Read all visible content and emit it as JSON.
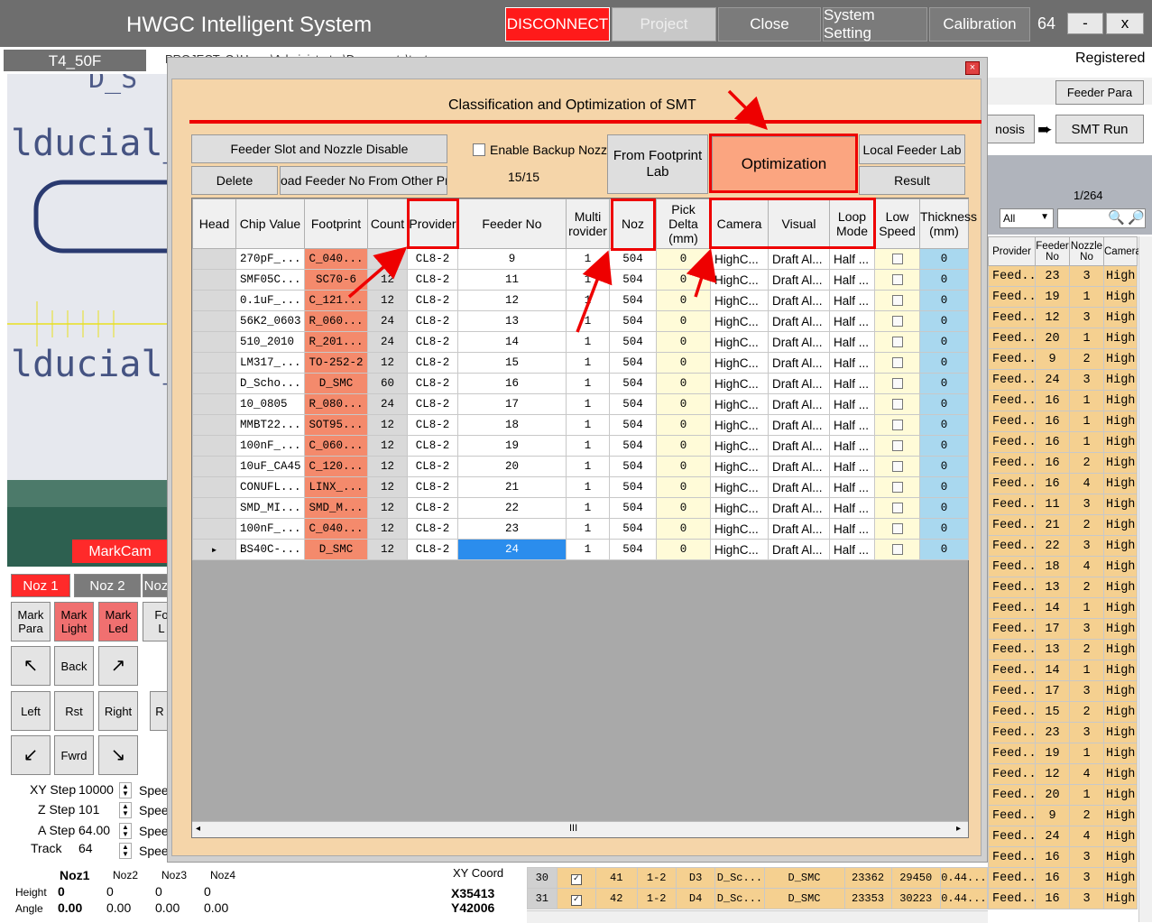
{
  "app": {
    "title": "HWGC Intelligent System",
    "disconnect": "DISCONNECT",
    "project": "Project",
    "close": "Close",
    "system_setting": "System Setting",
    "calibration": "Calibration",
    "count": "64",
    "minimize": "-",
    "close_x": "x"
  },
  "subbar": {
    "tab": "T4_50F",
    "path": "PROJECT: C:\\Users\\Administrator\\Documents\\test.pr",
    "registered": "Registered"
  },
  "right_panel": {
    "feeder_para": "Feeder Para",
    "diagnosis": "nosis",
    "smt_run": "SMT Run",
    "page": "1/264",
    "filter": "All",
    "headers": [
      "Provider",
      "Feeder No",
      "Nozzle No",
      "Camera"
    ],
    "rows": [
      [
        "Feed...",
        "23",
        "3",
        "High"
      ],
      [
        "Feed...",
        "19",
        "1",
        "High"
      ],
      [
        "Feed...",
        "12",
        "3",
        "High"
      ],
      [
        "Feed...",
        "20",
        "1",
        "High"
      ],
      [
        "Feed...",
        "9",
        "2",
        "High"
      ],
      [
        "Feed...",
        "24",
        "3",
        "High"
      ],
      [
        "Feed...",
        "16",
        "1",
        "High"
      ],
      [
        "Feed...",
        "16",
        "1",
        "High"
      ],
      [
        "Feed...",
        "16",
        "1",
        "High"
      ],
      [
        "Feed...",
        "16",
        "2",
        "High"
      ],
      [
        "Feed...",
        "16",
        "4",
        "High"
      ],
      [
        "Feed...",
        "11",
        "3",
        "High"
      ],
      [
        "Feed...",
        "21",
        "2",
        "High"
      ],
      [
        "Feed...",
        "22",
        "3",
        "High"
      ],
      [
        "Feed...",
        "18",
        "4",
        "High"
      ],
      [
        "Feed...",
        "13",
        "2",
        "High"
      ],
      [
        "Feed...",
        "14",
        "1",
        "High"
      ],
      [
        "Feed...",
        "17",
        "3",
        "High"
      ],
      [
        "Feed...",
        "13",
        "2",
        "High"
      ],
      [
        "Feed...",
        "14",
        "1",
        "High"
      ],
      [
        "Feed...",
        "17",
        "3",
        "High"
      ],
      [
        "Feed...",
        "15",
        "2",
        "High"
      ],
      [
        "Feed...",
        "23",
        "3",
        "High"
      ],
      [
        "Feed...",
        "19",
        "1",
        "High"
      ],
      [
        "Feed...",
        "12",
        "4",
        "High"
      ],
      [
        "Feed...",
        "20",
        "1",
        "High"
      ],
      [
        "Feed...",
        "9",
        "2",
        "High"
      ],
      [
        "Feed...",
        "24",
        "4",
        "High"
      ],
      [
        "Feed...",
        "16",
        "3",
        "High"
      ],
      [
        "Feed...",
        "16",
        "3",
        "High"
      ],
      [
        "Feed...",
        "16",
        "3",
        "High"
      ]
    ],
    "bottom_rows": [
      [
        "30",
        "41",
        "1-2",
        "D3",
        "D_Sc...",
        "D_SMC",
        "23362",
        "29450",
        "0.44..."
      ],
      [
        "31",
        "42",
        "1-2",
        "D4",
        "D_Sc...",
        "D_SMC",
        "23353",
        "30223",
        "0.44..."
      ]
    ]
  },
  "left": {
    "markcam": "MarkCam",
    "noz1": "Noz 1",
    "noz2": "Noz 2",
    "noz3": "Noz",
    "mark_para": "Mark Para",
    "mark_light": "Mark Light",
    "mark_led": "Mark Led",
    "fo": "Fo L",
    "back": "Back",
    "left": "Left",
    "rst": "Rst",
    "right": "Right",
    "fwrd": "Fwrd",
    "r": "R",
    "xy_step_label": "XY Step",
    "xy_step": "10000",
    "z_step_label": "Z Step",
    "z_step": "101",
    "a_step_label": "A Step",
    "a_step": "64.00",
    "track_label": "Track",
    "track": "64",
    "speed": "Spee",
    "noz_cols": [
      "Noz1",
      "Noz2",
      "Noz3",
      "Noz4"
    ],
    "height_label": "Height",
    "angle_label": "Angle",
    "heights": [
      "0",
      "0",
      "0",
      "0"
    ],
    "angles": [
      "0.00",
      "0.00",
      "0.00",
      "0.00"
    ],
    "xy_coord": "XY Coord",
    "x_coord": "X35413",
    "y_coord": "Y42006"
  },
  "dialog": {
    "title": "Classification and Optimization of SMT",
    "feeder_slot": "Feeder Slot and Nozzle Disable",
    "enable_backup": "Enable Backup Nozzle",
    "from_footprint": "From Footprint Lab",
    "optimization": "Optimization",
    "local_feeder": "Local Feeder Lab",
    "delete": "Delete",
    "load_feeder": "oad Feeder No From Other Prjec",
    "count_ratio": "15/15",
    "result": "Result",
    "headers": [
      "Head",
      "Chip Value",
      "Footprint",
      "Count",
      "Provider",
      "Feeder No",
      "Multi rovider",
      "Noz",
      "Pick Delta (mm)",
      "Camera",
      "Visual",
      "Loop Mode",
      "Low Speed",
      "Thickness (mm)"
    ],
    "rows": [
      [
        "",
        "270pF_...",
        "C_040...",
        "1",
        "CL8-2",
        "9",
        "1",
        "504",
        "0",
        "HighC...",
        "Draft Al...",
        "Half ...",
        "0"
      ],
      [
        "",
        "SMF05C...",
        "SC70-6",
        "12",
        "CL8-2",
        "11",
        "1",
        "504",
        "0",
        "HighC...",
        "Draft Al...",
        "Half ...",
        "0"
      ],
      [
        "",
        "0.1uF_...",
        "C_121...",
        "12",
        "CL8-2",
        "12",
        "1",
        "504",
        "0",
        "HighC...",
        "Draft Al...",
        "Half ...",
        "0"
      ],
      [
        "",
        "56K2_0603",
        "R_060...",
        "24",
        "CL8-2",
        "13",
        "1",
        "504",
        "0",
        "HighC...",
        "Draft Al...",
        "Half ...",
        "0"
      ],
      [
        "",
        "510_2010",
        "R_201...",
        "24",
        "CL8-2",
        "14",
        "1",
        "504",
        "0",
        "HighC...",
        "Draft Al...",
        "Half ...",
        "0"
      ],
      [
        "",
        "LM317_...",
        "TO-252-2",
        "12",
        "CL8-2",
        "15",
        "1",
        "504",
        "0",
        "HighC...",
        "Draft Al...",
        "Half ...",
        "0"
      ],
      [
        "",
        "D_Scho...",
        "D_SMC",
        "60",
        "CL8-2",
        "16",
        "1",
        "504",
        "0",
        "HighC...",
        "Draft Al...",
        "Half ...",
        "0"
      ],
      [
        "",
        "10_0805",
        "R_080...",
        "24",
        "CL8-2",
        "17",
        "1",
        "504",
        "0",
        "HighC...",
        "Draft Al...",
        "Half ...",
        "0"
      ],
      [
        "",
        "MMBT22...",
        "SOT95...",
        "12",
        "CL8-2",
        "18",
        "1",
        "504",
        "0",
        "HighC...",
        "Draft Al...",
        "Half ...",
        "0"
      ],
      [
        "",
        "100nF_...",
        "C_060...",
        "12",
        "CL8-2",
        "19",
        "1",
        "504",
        "0",
        "HighC...",
        "Draft Al...",
        "Half ...",
        "0"
      ],
      [
        "",
        "10uF_CA45",
        "C_120...",
        "12",
        "CL8-2",
        "20",
        "1",
        "504",
        "0",
        "HighC...",
        "Draft Al...",
        "Half ...",
        "0"
      ],
      [
        "",
        "CONUFL...",
        "LINX_...",
        "12",
        "CL8-2",
        "21",
        "1",
        "504",
        "0",
        "HighC...",
        "Draft Al...",
        "Half ...",
        "0"
      ],
      [
        "",
        "SMD_MI...",
        "SMD_M...",
        "12",
        "CL8-2",
        "22",
        "1",
        "504",
        "0",
        "HighC...",
        "Draft Al...",
        "Half ...",
        "0"
      ],
      [
        "",
        "100nF_...",
        "C_040...",
        "12",
        "CL8-2",
        "23",
        "1",
        "504",
        "0",
        "HighC...",
        "Draft Al...",
        "Half ...",
        "0"
      ],
      [
        "▸",
        "BS40C-...",
        "D_SMC",
        "12",
        "CL8-2",
        "24",
        "1",
        "504",
        "0",
        "HighC...",
        "Draft Al...",
        "Half ...",
        "0"
      ]
    ],
    "scroll_mid": "III"
  },
  "colors": {
    "annotation": "#e00000",
    "accent_orange": "#f48a6c",
    "selected": "#2b8ded"
  }
}
